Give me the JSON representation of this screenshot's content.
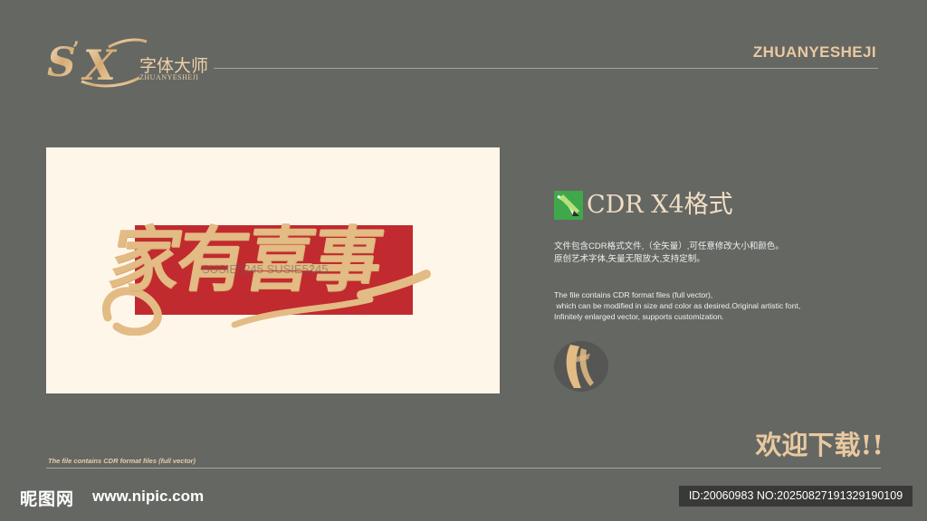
{
  "header": {
    "logo_cn": "字体大师",
    "logo_en": "ZHUANYESHEJI",
    "site_en": "ZHUANYESHEJI"
  },
  "artwork": {
    "title": "家有喜事",
    "watermark": "SUSIE5245 SUSIE5245"
  },
  "info": {
    "format_title": "CDR X4格式",
    "desc_cn_lines": [
      "文件包含CDR格式文件,（全矢量）,可任意修改大小和颜色。",
      "原创艺术字体,矢量无限放大,支持定制。"
    ],
    "desc_en_lines": [
      "The file contains CDR format files (full vector),",
      " which can be modified in size and color as desired.Original artistic font,",
      "Infinitely enlarged vector, supports customization."
    ]
  },
  "footer": {
    "welcome": "欢迎下载!!",
    "note": "The file contains CDR format files (full vector)",
    "nipic_logo": "昵图网",
    "nipic_url": "www.nipic.com",
    "id_text": "ID:20060983 NO:20250827191329190109"
  },
  "colors": {
    "background": "#656763",
    "gold": "#e3bb84",
    "red": "#c12a2e",
    "panel": "#fff6ea"
  },
  "icons": [
    "sx-logo-icon",
    "cdr-icon",
    "brush-icon"
  ]
}
